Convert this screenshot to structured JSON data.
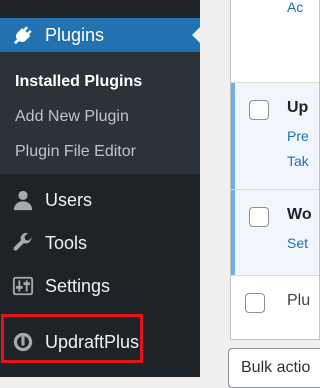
{
  "sidebar": {
    "items": [
      {
        "label": "Plugins",
        "icon": "plugin-icon",
        "active": true
      },
      {
        "label": "Users",
        "icon": "users-icon"
      },
      {
        "label": "Tools",
        "icon": "wrench-icon"
      },
      {
        "label": "Settings",
        "icon": "settings-sliders-icon"
      },
      {
        "label": "UpdraftPlus",
        "icon": "updraftplus-icon"
      }
    ],
    "submenu": [
      {
        "label": "Installed Plugins",
        "current": true
      },
      {
        "label": "Add New Plugin"
      },
      {
        "label": "Plugin File Editor"
      }
    ]
  },
  "plugins": {
    "top_partial_link": "Ac",
    "rows": [
      {
        "name": "Up",
        "link1": "Pre",
        "link2": "Tak"
      },
      {
        "name": "Wo",
        "link1": "Set"
      },
      {
        "name": "Plu"
      }
    ]
  },
  "bulk_actions": {
    "label": "Bulk actio"
  },
  "colors": {
    "sidebar_bg": "#1d2327",
    "submenu_bg": "#2c3338",
    "accent": "#2271b1",
    "highlight": "#e3121b",
    "update_border": "#72aee6"
  }
}
